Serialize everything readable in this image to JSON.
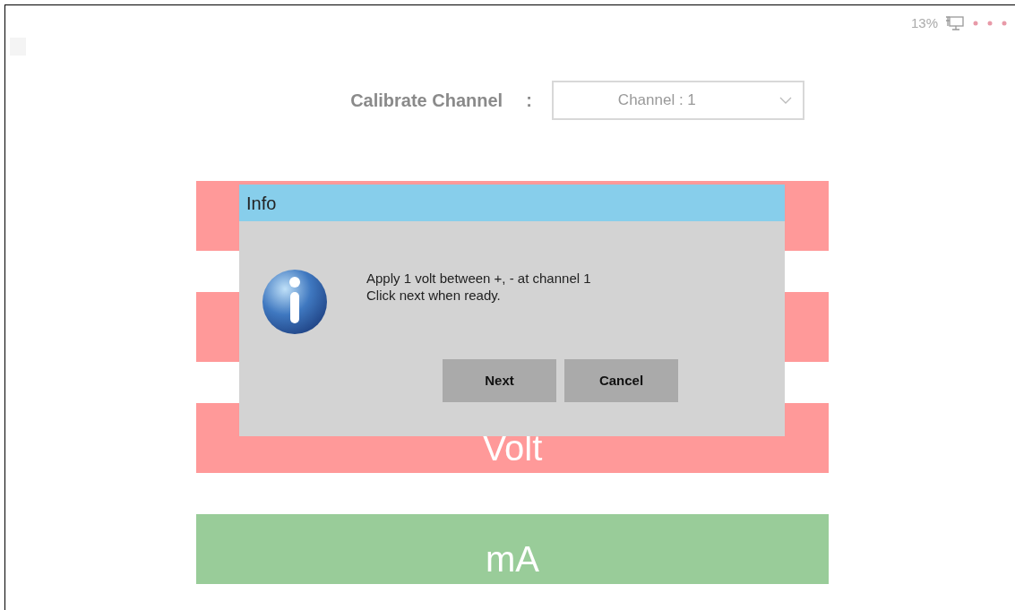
{
  "status": {
    "battery": "13%"
  },
  "calibrate": {
    "label": "Calibrate Channel",
    "separator": ":",
    "dropdown_value": "Channel : 1"
  },
  "mode_buttons": [
    {
      "color": "#ff9999"
    },
    {
      "color": "#ff9999"
    },
    {
      "label": "Volt",
      "color": "#ff9999"
    },
    {
      "label": "mA",
      "color": "#99cc99"
    }
  ],
  "dialog": {
    "title": "Info",
    "message_lines": [
      "Apply 1 volt between +, - at channel 1",
      "Click next when ready."
    ],
    "buttons": [
      "Next",
      "Cancel"
    ]
  }
}
